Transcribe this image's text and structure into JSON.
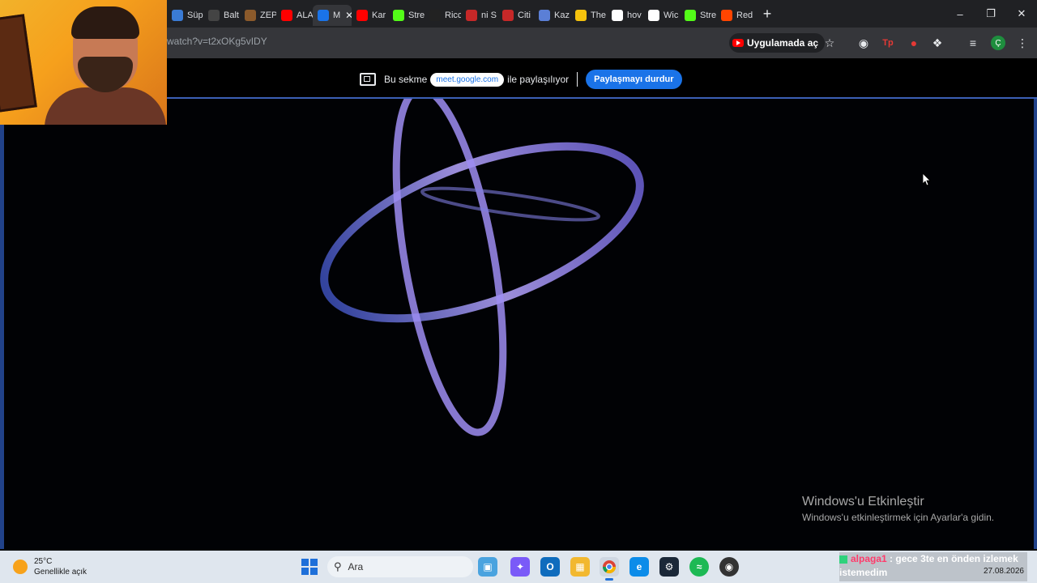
{
  "browser": {
    "tabs": [
      {
        "label": "Süp",
        "icon": "bird-icon",
        "color": "#3a7bd5"
      },
      {
        "label": "Balt",
        "icon": "logo-icon",
        "color": "#444"
      },
      {
        "label": "ZEP",
        "icon": "zep-icon",
        "color": "#8b5a2b"
      },
      {
        "label": "ALA",
        "icon": "youtube-icon",
        "color": "#ff0000"
      },
      {
        "label": "M",
        "icon": "meet-icon",
        "color": "#1a73e8",
        "active": true
      },
      {
        "label": "Kar",
        "icon": "youtube-icon",
        "color": "#ff0000"
      },
      {
        "label": "Stre",
        "icon": "kick-icon",
        "color": "#53fc18"
      },
      {
        "label": "Ricc",
        "icon": "dark-icon",
        "color": "#222"
      },
      {
        "label": "ni S",
        "icon": "circle-icon",
        "color": "#c62828"
      },
      {
        "label": "Citi",
        "icon": "circle-icon",
        "color": "#c62828"
      },
      {
        "label": "Kaz",
        "icon": "doc-icon",
        "color": "#5b7fd6"
      },
      {
        "label": "The",
        "icon": "note-icon",
        "color": "#f4c20d"
      },
      {
        "label": "hov",
        "icon": "google-icon",
        "color": "#fff"
      },
      {
        "label": "Wic",
        "icon": "tag-icon",
        "color": "#fff"
      },
      {
        "label": "Stre",
        "icon": "kick-icon",
        "color": "#53fc18"
      },
      {
        "label": "Red",
        "icon": "reddit-icon",
        "color": "#ff4500"
      }
    ],
    "url": "watch?v=t2xOKg5vIDY",
    "open_in_app": "Uygulamada aç"
  },
  "sharing": {
    "prefix": "Bu sekme",
    "domain": "meet.google.com",
    "suffix": "ile paylaşılıyor",
    "stop_label": "Paylaşmayı durdur"
  },
  "watermark": {
    "title": "Windows'u Etkinleştir",
    "subtitle": "Windows'u etkinleştirmek için Ayarlar'a gidin."
  },
  "taskbar": {
    "temperature": "25°C",
    "weather": "Genellikle açık",
    "search_placeholder": "Ara",
    "date": "27.08.2026"
  },
  "chat_overlay": {
    "user": "alpaga1",
    "message": ": gece 3te en önden izlemek istemedim"
  }
}
